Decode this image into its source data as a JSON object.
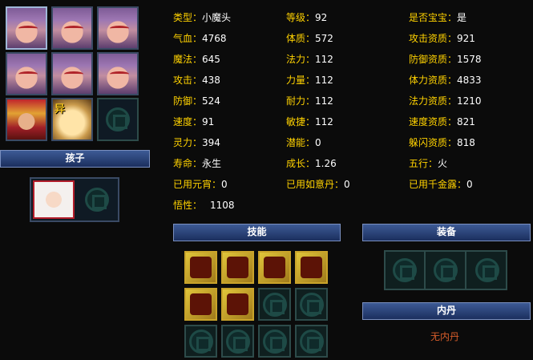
{
  "panel": {
    "name_bar": "孩子",
    "skills_bar": "技能",
    "equipment_bar": "装备",
    "inner_core_bar": "内丹",
    "inner_core_none": "无内丹",
    "portrait_badge": "异"
  },
  "stats": [
    {
      "label": "类型：",
      "value": "小魔头"
    },
    {
      "label": "等级：",
      "value": "92"
    },
    {
      "label": "是否宝宝：",
      "value": "是"
    },
    {
      "label": "气血：",
      "value": "4768"
    },
    {
      "label": "体质：",
      "value": "572"
    },
    {
      "label": "攻击资质：",
      "value": "921"
    },
    {
      "label": "魔法：",
      "value": "645"
    },
    {
      "label": "法力：",
      "value": "112"
    },
    {
      "label": "防御资质：",
      "value": "1578"
    },
    {
      "label": "攻击：",
      "value": "438"
    },
    {
      "label": "力量：",
      "value": "112"
    },
    {
      "label": "体力资质：",
      "value": "4833"
    },
    {
      "label": "防御：",
      "value": "524"
    },
    {
      "label": "耐力：",
      "value": "112"
    },
    {
      "label": "法力资质：",
      "value": "1210"
    },
    {
      "label": "速度：",
      "value": "91"
    },
    {
      "label": "敏捷：",
      "value": "112"
    },
    {
      "label": "速度资质：",
      "value": "821"
    },
    {
      "label": "灵力：",
      "value": "394"
    },
    {
      "label": "潜能：",
      "value": "0"
    },
    {
      "label": "躲闪资质：",
      "value": "818"
    },
    {
      "label": "寿命：",
      "value": "永生"
    },
    {
      "label": "成长：",
      "value": "1.26"
    },
    {
      "label": "五行：",
      "value": "火"
    },
    {
      "label": "已用元宵：",
      "value": "0"
    },
    {
      "label": "已用如意丹：",
      "value": "0"
    },
    {
      "label": "已用千金露：",
      "value": "0"
    },
    {
      "label": "悟性：",
      "value": "1108"
    }
  ],
  "colors": {
    "label": "#ffd200",
    "value": "#ffffff",
    "bar": "#2a4680",
    "none_text": "#d55c2a"
  },
  "icons": {
    "empty_slot": "empty-slot-emblem-icon",
    "skills": [
      "skill-horn-icon",
      "skill-beast-icon",
      "skill-demon-icon",
      "skill-flame-icon",
      "skill-eye-icon",
      "skill-soldiers-icon"
    ]
  }
}
